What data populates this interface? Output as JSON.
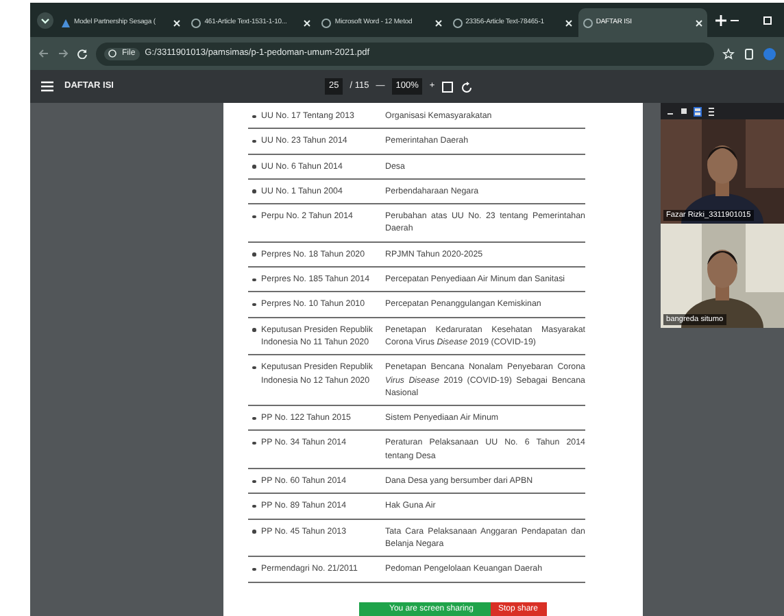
{
  "tabs": [
    {
      "title": "Model Partnership Sesaga (",
      "selected": false
    },
    {
      "title": "461-Article Text-1531-1-10...",
      "selected": false
    },
    {
      "title": "Microsoft Word - 12 Metod",
      "selected": false
    },
    {
      "title": "23356-Article Text-78465-1",
      "selected": false
    },
    {
      "title": "DAFTAR ISI",
      "selected": true
    }
  ],
  "address_bar": {
    "scheme": "File",
    "url": "G:/3311901013/pamsimas/p-1-pedoman-umum-2021.pdf"
  },
  "pdf_toolbar": {
    "title": "DAFTAR ISI",
    "page": "25",
    "page_count": "/ 115",
    "zoom_out": "—",
    "zoom": "100%",
    "zoom_in": "+"
  },
  "table": {
    "rows": [
      {
        "col_1": "UU No. 17 Tentang 2013",
        "col_2": "Organisasi Kemasyarakatan"
      },
      {
        "col_1": "UU No. 23 Tahun 2014",
        "col_2": "Pemerintahan Daerah"
      },
      {
        "col_1": "UU No. 6 Tahun 2014",
        "col_2": "Desa"
      },
      {
        "col_1": "UU No. 1 Tahun 2004",
        "col_2": "Perbendaharaan Negara"
      },
      {
        "col_1": "Perpu No. 2 Tahun 2014",
        "col_2": "Perubahan atas UU No. 23 tentang Pemerintahan Daerah"
      },
      {
        "col_1": "Perpres No. 18 Tahun 2020",
        "col_2": "RPJMN Tahun 2020-2025"
      },
      {
        "col_1": "Perpres No. 185 Tahun 2014",
        "col_2": "Percepatan Penyediaan Air Minum dan Sanitasi"
      },
      {
        "col_1": "Perpres No. 10 Tahun 2010",
        "col_2": "Percepatan Penanggulangan Kemiskinan"
      },
      {
        "col_1": "Keputusan Presiden Republik Indonesia No 11 Tahun 2020",
        "col_2": "Penetapan Kedaruratan Kesehatan Masyarakat Corona Virus *Disease* 2019 (COVID-19)"
      },
      {
        "col_1": "Keputusan Presiden Republik Indonesia No 12 Tahun 2020",
        "col_2": "Penetapan Bencana Nonalam Penyebaran Corona *Virus Disease* 2019 (COVID-19) Sebagai Bencana Nasional"
      },
      {
        "col_1": "PP No. 122 Tahun 2015",
        "col_2": "Sistem Penyediaan Air Minum"
      },
      {
        "col_1": "PP No. 34 Tahun 2014",
        "col_2": "Peraturan Pelaksanaan UU No. 6 Tahun 2014 tentang Desa"
      },
      {
        "col_1": "PP No. 60 Tahun 2014",
        "col_2": "Dana Desa yang bersumber dari APBN"
      },
      {
        "col_1": "PP No. 89 Tahun 2014",
        "col_2": "Hak Guna Air"
      },
      {
        "col_1": "PP No. 45 Tahun 2013",
        "col_2": "Tata Cara Pelaksanaan Anggaran Pendapatan dan Belanja Negara"
      },
      {
        "col_1": "Permendagri No. 21/2011",
        "col_2": "Pedoman Pengelolaan Keuangan Daerah"
      }
    ]
  },
  "video_call": {
    "participants": [
      {
        "name": "Fazar Rizki_3311901015",
        "kind": "picture"
      },
      {
        "name": "bangreda situmo",
        "kind": "picture"
      }
    ]
  },
  "screen_share": {
    "message": "You are screen sharing",
    "stop_label": "Stop share"
  }
}
